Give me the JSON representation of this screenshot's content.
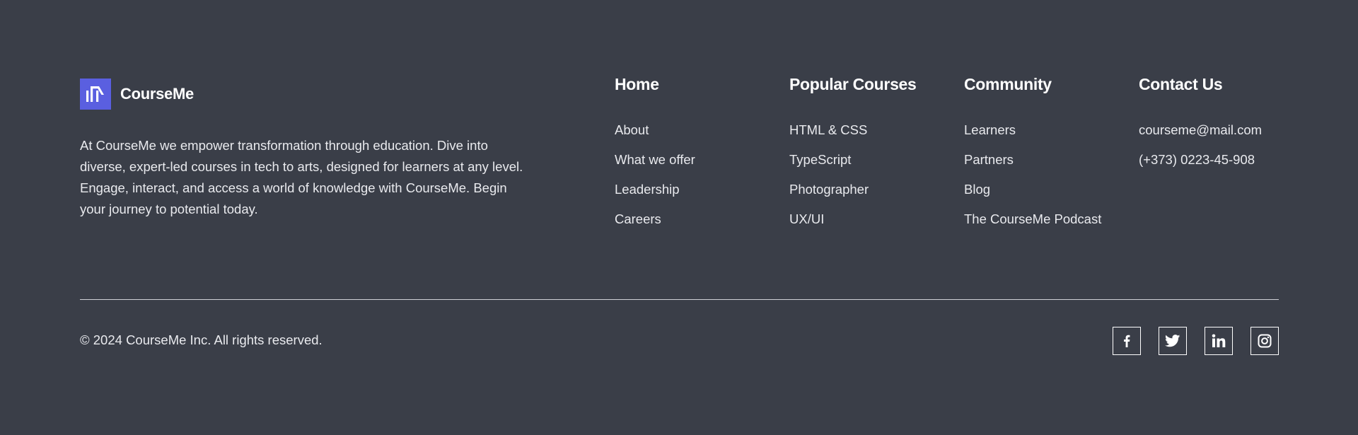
{
  "brand": {
    "name": "CourseMe",
    "logo_color": "#5a5fe0",
    "description": "At CourseMe we empower transformation through education. Dive into diverse, expert-led courses in tech to arts, designed for learners at any level. Engage, interact, and access a world of knowledge with CourseMe. Begin your journey to potential today."
  },
  "columns": {
    "home": {
      "heading": "Home",
      "links": [
        "About",
        "What we offer",
        "Leadership",
        "Careers"
      ]
    },
    "courses": {
      "heading": "Popular Courses",
      "links": [
        "HTML & CSS",
        "TypeScript",
        "Photographer",
        "UX/UI"
      ]
    },
    "community": {
      "heading": "Community",
      "links": [
        "Learners",
        "Partners",
        "Blog",
        "The CourseMe Podcast"
      ]
    },
    "contact": {
      "heading": "Contact Us",
      "links": [
        "courseme@mail.com",
        "(+373) 0223-45-908"
      ]
    }
  },
  "bottom": {
    "copyright": "© 2024 CourseMe Inc. All rights reserved."
  },
  "socials": [
    {
      "icon": "facebook-icon"
    },
    {
      "icon": "twitter-icon"
    },
    {
      "icon": "linkedin-icon"
    },
    {
      "icon": "instagram-icon"
    }
  ],
  "colors": {
    "background": "#3a3e48",
    "text": "#ffffff",
    "accent": "#5a5fe0"
  }
}
